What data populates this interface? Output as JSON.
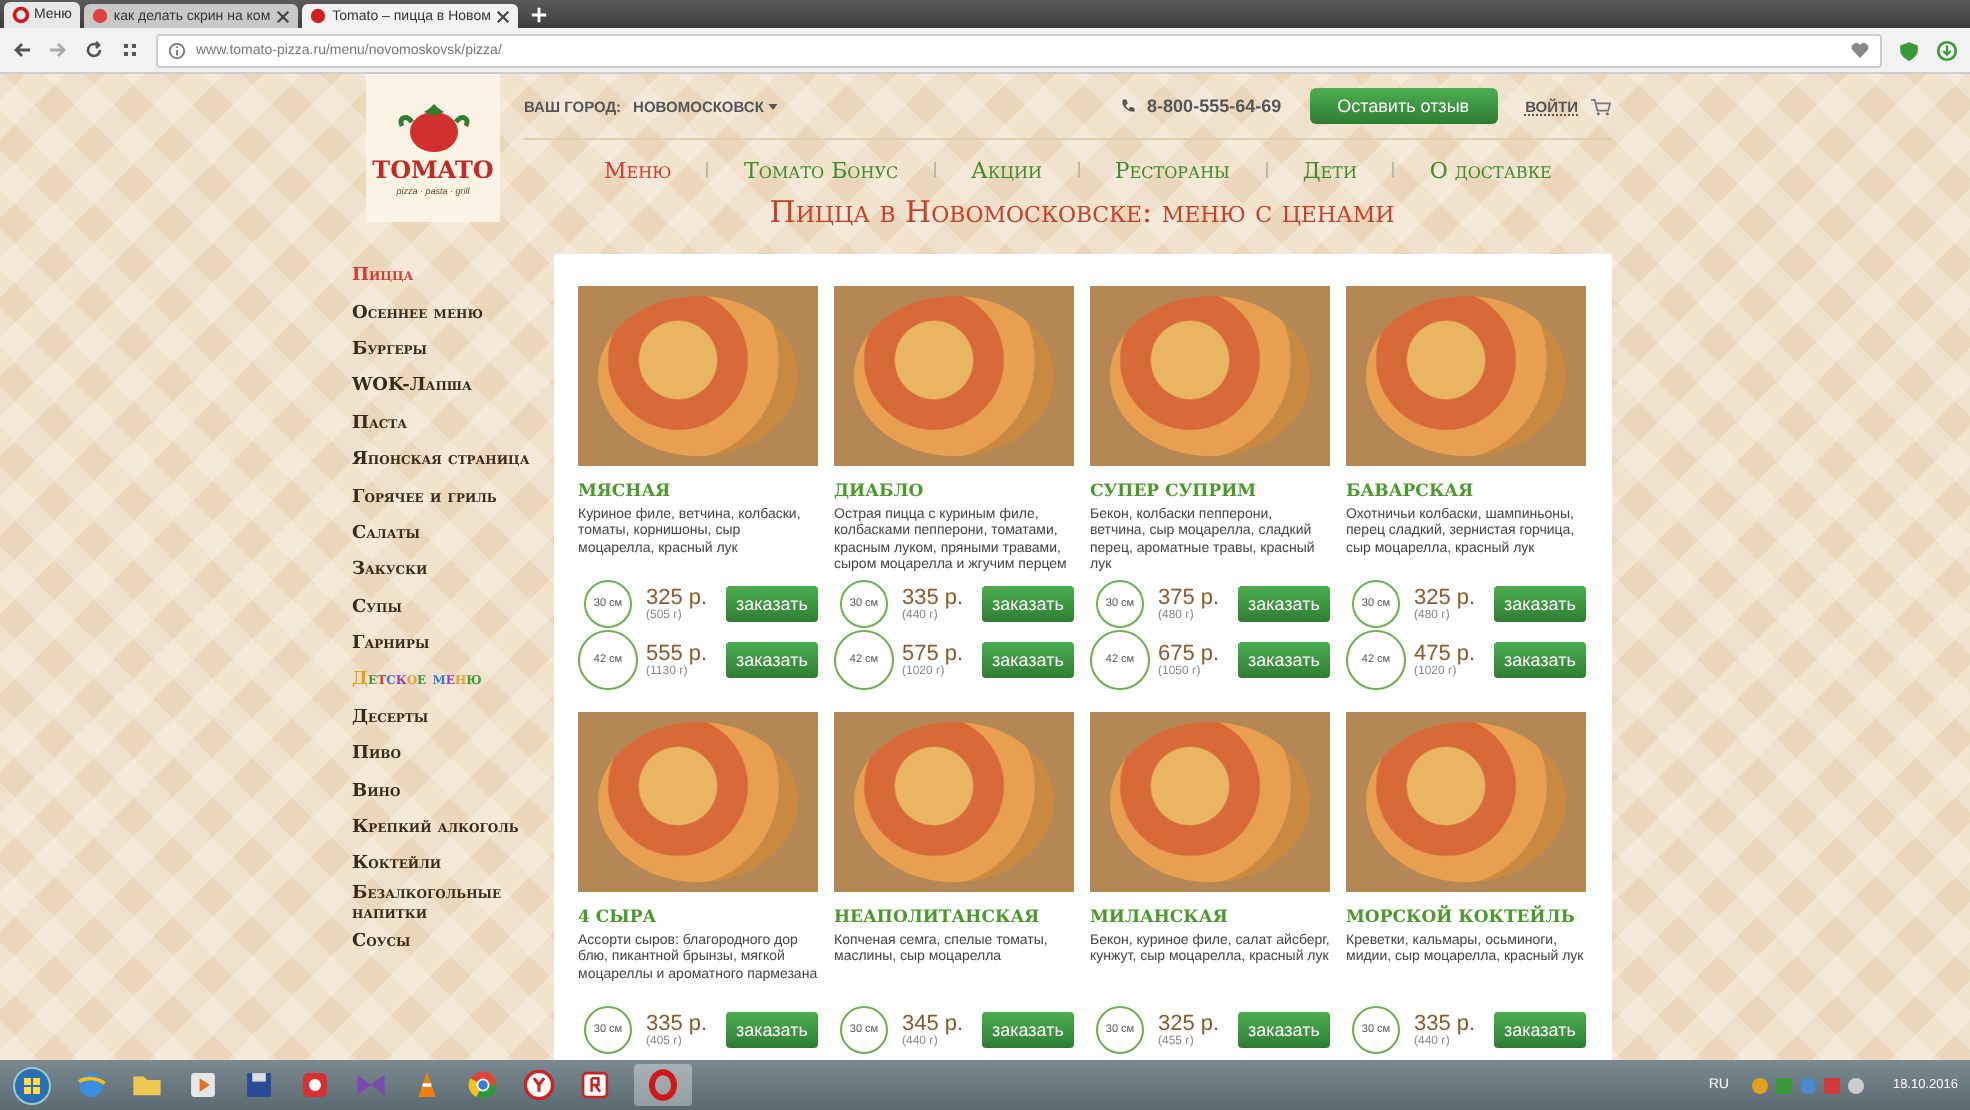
{
  "browser": {
    "tabs": [
      {
        "label": "Меню",
        "kind": "menu",
        "selected": false
      },
      {
        "label": "как делать скрин на ком",
        "kind": "tab",
        "selected": false
      },
      {
        "label": "Tomato – пицца в Новом",
        "kind": "tab",
        "selected": true
      }
    ],
    "address": "www.tomato-pizza.ru/menu/novomoskovsk/pizza/"
  },
  "site": {
    "logo": {
      "name": "TOMATO",
      "tagline": "pizza · pasta · grill"
    },
    "city_label": "ВАШ ГОРОД:",
    "city": "НОВОМОСКОВСК",
    "phone": "8-800-555-64-69",
    "review_button": "Оставить отзыв",
    "login": "ВОЙТИ",
    "nav": [
      {
        "label": "Меню",
        "selected": true
      },
      {
        "label": "Томато Бонус",
        "selected": false
      },
      {
        "label": "Акции",
        "selected": false
      },
      {
        "label": "Рестораны",
        "selected": false
      },
      {
        "label": "Дети",
        "selected": false
      },
      {
        "label": "О доставке",
        "selected": false
      }
    ],
    "title": "Пицца в Новомосковске: меню с ценами"
  },
  "sidebar": [
    {
      "label": "Пицца",
      "kind": "normal",
      "selected": true
    },
    {
      "label": "Осеннее меню",
      "kind": "normal",
      "selected": false
    },
    {
      "label": "Бургеры",
      "kind": "normal",
      "selected": false
    },
    {
      "label": "WOK-Лапша",
      "kind": "normal",
      "selected": false
    },
    {
      "label": "Паста",
      "kind": "normal",
      "selected": false
    },
    {
      "label": "Японская страница",
      "kind": "normal",
      "selected": false
    },
    {
      "label": "Горячее и гриль",
      "kind": "normal",
      "selected": false
    },
    {
      "label": "Салаты",
      "kind": "normal",
      "selected": false
    },
    {
      "label": "Закуски",
      "kind": "normal",
      "selected": false
    },
    {
      "label": "Супы",
      "kind": "normal",
      "selected": false
    },
    {
      "label": "Гарниры",
      "kind": "normal",
      "selected": false
    },
    {
      "label": "Детское меню",
      "kind": "kids",
      "selected": false
    },
    {
      "label": "Десерты",
      "kind": "normal",
      "selected": false
    },
    {
      "label": "Пиво",
      "kind": "normal",
      "selected": false
    },
    {
      "label": "Вино",
      "kind": "normal",
      "selected": false
    },
    {
      "label": "Крепкий алкоголь",
      "kind": "normal",
      "selected": false
    },
    {
      "label": "Коктейли",
      "kind": "normal",
      "selected": false
    },
    {
      "label": "Безалкогольные напитки",
      "kind": "normal",
      "selected": false
    },
    {
      "label": "Соусы",
      "kind": "normal",
      "selected": false
    }
  ],
  "products": [
    {
      "name": "МЯСНАЯ",
      "description": "Куриное филе, ветчина, колбаски, томаты, корнишоны, сыр моцарелла, красный лук",
      "sizes": [
        {
          "kind": "small",
          "size": "30 см",
          "price": "325 р.",
          "weight": "(505 г)",
          "button": "заказать"
        },
        {
          "kind": "large",
          "size": "42 см",
          "price": "555 р.",
          "weight": "(1130 г)",
          "button": "заказать"
        }
      ]
    },
    {
      "name": "ДИАБЛО",
      "description": "Острая пицца с куриным филе, колбасками пепперони, томатами, красным луком, пряными травами, сыром моцарелла и жгучим перцем",
      "sizes": [
        {
          "kind": "small",
          "size": "30 см",
          "price": "335 р.",
          "weight": "(440 г)",
          "button": "заказать"
        },
        {
          "kind": "large",
          "size": "42 см",
          "price": "575 р.",
          "weight": "(1020 г)",
          "button": "заказать"
        }
      ]
    },
    {
      "name": "СУПЕР СУПРИМ",
      "description": "Бекон, колбаски пепперони, ветчина, сыр моцарелла, сладкий перец, ароматные травы, красный лук",
      "sizes": [
        {
          "kind": "small",
          "size": "30 см",
          "price": "375 р.",
          "weight": "(480 г)",
          "button": "заказать"
        },
        {
          "kind": "large",
          "size": "42 см",
          "price": "675 р.",
          "weight": "(1050 г)",
          "button": "заказать"
        }
      ]
    },
    {
      "name": "БАВАРСКАЯ",
      "description": "Охотничьи колбаски, шампиньоны, перец сладкий, зернистая горчица, сыр моцарелла, красный лук",
      "sizes": [
        {
          "kind": "small",
          "size": "30 см",
          "price": "325 р.",
          "weight": "(480 г)",
          "button": "заказать"
        },
        {
          "kind": "large",
          "size": "42 см",
          "price": "475 р.",
          "weight": "(1020 г)",
          "button": "заказать"
        }
      ]
    },
    {
      "name": "4 СЫРА",
      "description": "Ассорти сыров: благородного дор блю, пикантной брынзы, мягкой моцареллы и ароматного пармезана",
      "sizes": [
        {
          "kind": "small",
          "size": "30 см",
          "price": "335 р.",
          "weight": "(405 г)",
          "button": "заказать"
        }
      ]
    },
    {
      "name": "НЕАПОЛИТАНСКАЯ",
      "description": "Копченая семга, спелые томаты, маслины, сыр моцарелла",
      "sizes": [
        {
          "kind": "small",
          "size": "30 см",
          "price": "345 р.",
          "weight": "(440 г)",
          "button": "заказать"
        }
      ]
    },
    {
      "name": "МИЛАНСКАЯ",
      "description": "Бекон, куриное филе, салат айсберг, кунжут, сыр моцарелла, красный лук",
      "sizes": [
        {
          "kind": "small",
          "size": "30 см",
          "price": "325 р.",
          "weight": "(455 г)",
          "button": "заказать"
        }
      ]
    },
    {
      "name": "МОРСКОЙ КОКТЕЙЛЬ",
      "description": "Креветки, кальмары, осьминоги, мидии, сыр моцарелла, красный лук",
      "sizes": [
        {
          "kind": "small",
          "size": "30 см",
          "price": "335 р.",
          "weight": "(440 г)",
          "button": "заказать"
        }
      ]
    }
  ],
  "taskbar": {
    "language": "RU",
    "date": "18.10.2016"
  }
}
